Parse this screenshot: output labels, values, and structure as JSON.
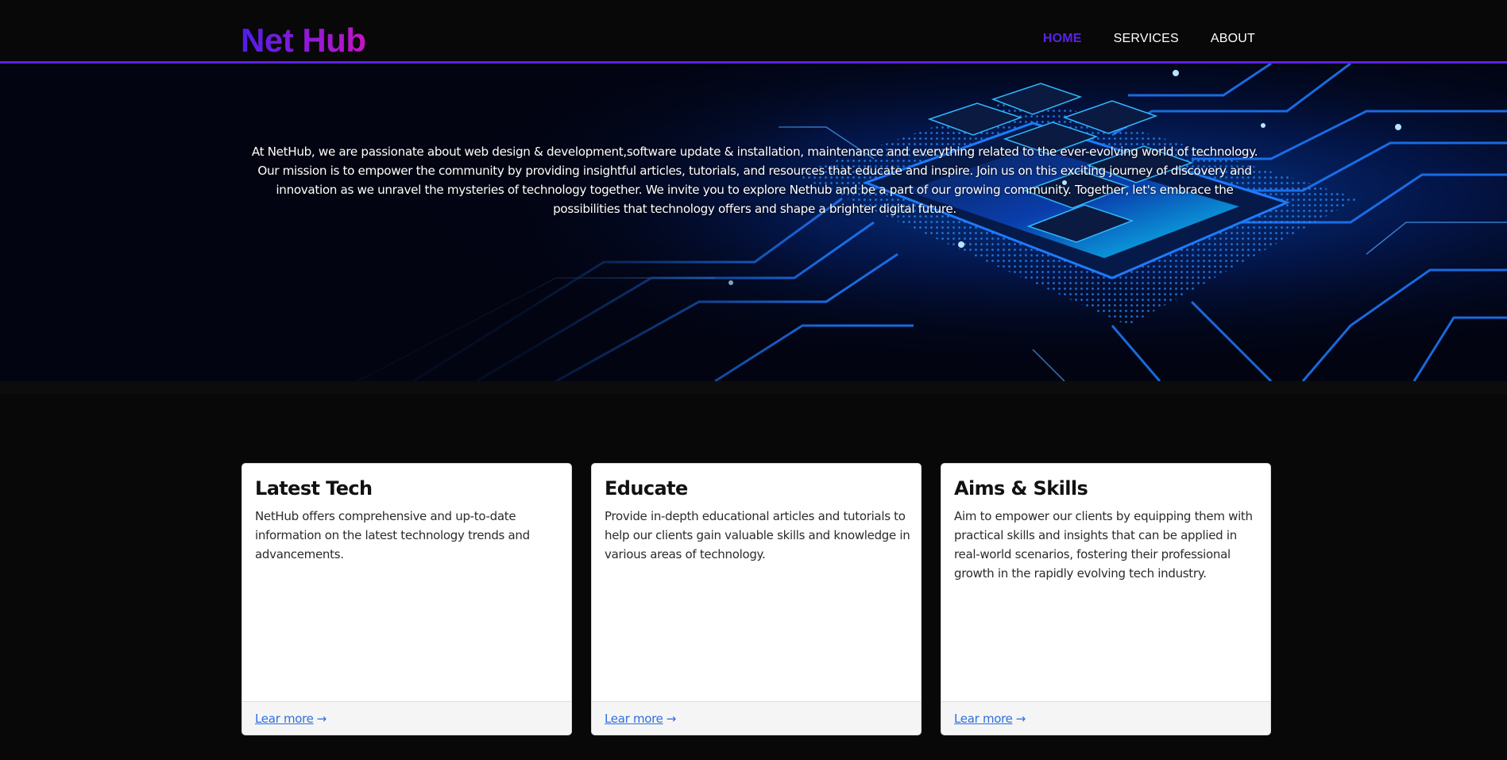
{
  "header": {
    "logo": "Net Hub",
    "nav": [
      {
        "label": "HOME",
        "active": true
      },
      {
        "label": "SERVICES",
        "active": false
      },
      {
        "label": "ABOUT",
        "active": false
      }
    ]
  },
  "hero": {
    "text": "At NetHub, we are passionate about web design & development,software update & installation, maintenance and everything related to the ever-evolving world of technology. Our mission is to empower the community by providing insightful articles, tutorials, and resources that educate and inspire. Join us on this exciting journey of discovery and innovation as we unravel the mysteries of technology together. We invite you to explore Nethub and be a part of our growing community. Together, let's embrace the possibilities that technology offers and shape a brighter digital future.",
    "image": "circuit-board-chip-image"
  },
  "cards": [
    {
      "title": "Latest Tech",
      "text": "NetHub offers comprehensive and up-to-date information on the latest technology trends and advancements.",
      "link": "Lear more",
      "arrow": "→"
    },
    {
      "title": "Educate",
      "text": "Provide in-depth educational articles and tutorials to help our clients gain valuable skills and knowledge in various areas of technology.",
      "link": "Lear more",
      "arrow": "→"
    },
    {
      "title": "Aims & Skills",
      "text": "Aim to empower our clients by equipping them with practical skills and insights that can be applied in real-world scenarios, fostering their professional growth in the rapidly evolving tech industry.",
      "link": "Lear more",
      "arrow": "→"
    }
  ],
  "colors": {
    "accent": "#5b22e6",
    "background": "#080808",
    "link": "#2d6fe0"
  }
}
